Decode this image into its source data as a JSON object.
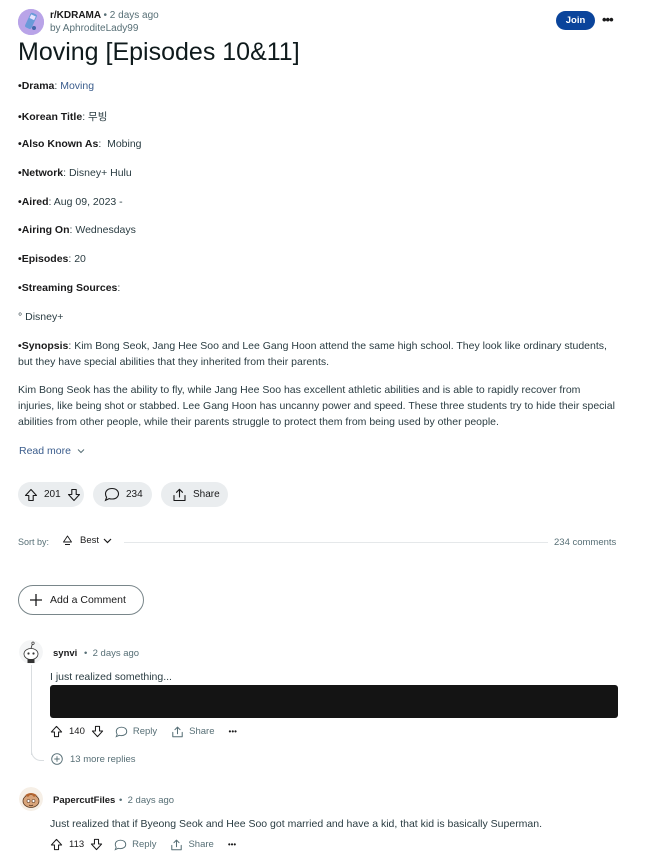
{
  "post": {
    "subreddit": "r/KDRAMA",
    "time": "• 2 days ago",
    "author": "by AphroditeLady99",
    "join_label": "Join",
    "more_label": "•••",
    "title": "Moving [Episodes 10&11]",
    "fields": [
      {
        "bullet": "•",
        "label": "Drama",
        "sep": ": ",
        "value": "Moving"
      },
      {
        "bullet": "•",
        "label": "Korean Title",
        "sep": ": ",
        "value": "무빙"
      },
      {
        "bullet": "•",
        "label": "Also Known As",
        "sep": ":  ",
        "value": "Mobing"
      },
      {
        "bullet": "•",
        "label": "Network",
        "sep": ": ",
        "value": "Disney+ Hulu"
      },
      {
        "bullet": "•",
        "label": "Aired",
        "sep": ": ",
        "value": "Aug 09, 2023 -"
      },
      {
        "bullet": "•",
        "label": "Airing On",
        "sep": ": ",
        "value": "Wednesdays"
      },
      {
        "bullet": "•",
        "label": "Episodes",
        "sep": ": ",
        "value": "20"
      },
      {
        "bullet": "•",
        "label": "Streaming Sources",
        "sep": ":",
        "value": ""
      }
    ],
    "streaming_item": "° Disney+",
    "synopsis_label": "Synopsis",
    "synopsis_text": ": Kim Bong Seok, Jang Hee Soo and Lee Gang Hoon attend the same high school. They look like ordinary students, but they have special abilities that they inherited from their parents.",
    "paragraph": "Kim Bong Seok has the ability to fly, while Jang Hee Soo has excellent athletic abilities and is able to rapidly recover from injuries, like being shot or stabbed. Lee Gang Hoon has uncanny power and speed. These three students try to hide their special abilities from other people, while their parents struggle to protect them from being used by other people.",
    "read_more": "Read more",
    "score": "201",
    "comments_count": "234",
    "share_label": "Share"
  },
  "sort": {
    "label": "Sort by:",
    "value": "Best",
    "total_comments": "234 comments"
  },
  "add_comment_label": "Add a Comment",
  "comments": [
    {
      "user": "synvi",
      "time": "2 days ago",
      "text": "I just realized something...",
      "score": "140",
      "reply": "Reply",
      "share": "Share",
      "more": "•••",
      "more_replies": "13 more replies"
    },
    {
      "user": "PapercutFiles",
      "time": "2 days ago",
      "text": "Just realized that if Byeong Seok and Hee Soo got married and have a kid, that kid is basically Superman.",
      "score": "113",
      "reply": "Reply",
      "share": "Share",
      "more": "•••"
    }
  ],
  "colors": {
    "join": "#0a449b",
    "pill": "#eaedef",
    "link": "#3a5c8c",
    "spoiler": "#141414"
  },
  "icons": [
    "upvote-icon",
    "downvote-icon",
    "comment-icon",
    "share-icon",
    "sort-icon",
    "chevron-down-icon",
    "plus-icon",
    "reply-icon",
    "more-icon"
  ]
}
